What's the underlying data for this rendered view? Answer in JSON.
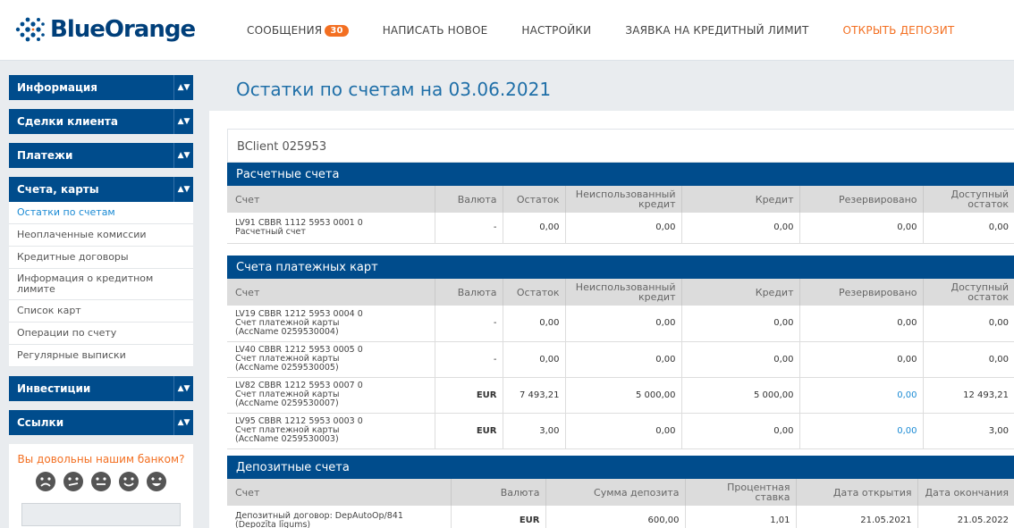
{
  "brand": {
    "name": "BlueOrange",
    "blue": "#004c8c",
    "orange": "#f36f21"
  },
  "nav": {
    "messages": "СООБЩЕНИЯ",
    "messages_count": "30",
    "compose": "НАПИСАТЬ НОВОЕ",
    "settings": "НАСТРОЙКИ",
    "credit_request": "ЗАЯВКА НА КРЕДИТНЫЙ ЛИМИТ",
    "open_deposit": "ОТКРЫТЬ ДЕПОЗИТ"
  },
  "sidebar": {
    "info": "Информация",
    "deals": "Сделки клиента",
    "payments": "Платежи",
    "accounts": "Счета, карты",
    "accounts_items": [
      "Остатки по счетам",
      "Неоплаченные комиссии",
      "Кредитные договоры",
      "Информация о кредитном лимите",
      "Список карт",
      "Операции по счету",
      "Регулярные выписки"
    ],
    "investments": "Инвестиции",
    "links": "Ссылки",
    "feedback_title": "Вы довольны нашим банком?"
  },
  "page": {
    "title": "Остатки по счетам на 03.06.2021",
    "client": "BClient 025953"
  },
  "current": {
    "title": "Расчетные счета",
    "headers": [
      "Счет",
      "Валюта",
      "Остаток",
      "Неиспользованный кредит",
      "Кредит",
      "Резервировано",
      "Доступный остаток"
    ],
    "rows": [
      {
        "acct": [
          "LV91 CBBR 1112 5953 0001 0",
          "Расчетный счет"
        ],
        "currency": "-",
        "balance": "0,00",
        "unused": "0,00",
        "credit": "0,00",
        "reserved": "0,00",
        "available": "0,00"
      }
    ]
  },
  "cards": {
    "title": "Счета платежных карт",
    "headers": [
      "Счет",
      "Валюта",
      "Остаток",
      "Неиспользованный кредит",
      "Кредит",
      "Резервировано",
      "Доступный остаток"
    ],
    "rows": [
      {
        "acct": [
          "LV19 CBBR 1212 5953 0004 0",
          "Счет платежной карты",
          "(AccName 0259530004)"
        ],
        "currency": "-",
        "balance": "0,00",
        "unused": "0,00",
        "credit": "0,00",
        "reserved": "0,00",
        "available": "0,00"
      },
      {
        "acct": [
          "LV40 CBBR 1212 5953 0005 0",
          "Счет платежной карты",
          "(AccName 0259530005)"
        ],
        "currency": "-",
        "balance": "0,00",
        "unused": "0,00",
        "credit": "0,00",
        "reserved": "0,00",
        "available": "0,00"
      },
      {
        "acct": [
          "LV82 CBBR 1212 5953 0007 0",
          "Счет платежной карты",
          "(AccName 0259530007)"
        ],
        "currency": "EUR",
        "balance": "7 493,21",
        "unused": "5 000,00",
        "credit": "5 000,00",
        "reserved": "0,00",
        "available": "12 493,21"
      },
      {
        "acct": [
          "LV95 CBBR 1212 5953 0003 0",
          "Счет платежной карты",
          "(AccName 0259530003)"
        ],
        "currency": "EUR",
        "balance": "3,00",
        "unused": "0,00",
        "credit": "0,00",
        "reserved": "0,00",
        "available": "3,00"
      }
    ]
  },
  "deposits": {
    "title": "Депозитные счета",
    "headers": [
      "Счет",
      "Валюта",
      "Сумма депозита",
      "Процентная ставка",
      "Дата открытия",
      "Дата окончания"
    ],
    "rows": [
      {
        "acct": [
          "Депозитный договор: DepAutoOp/841",
          "(Depozīta līgums)"
        ],
        "currency": "EUR",
        "amount": "600,00",
        "rate": "1,01",
        "opened": "21.05.2021",
        "ends": "21.05.2022"
      }
    ]
  }
}
